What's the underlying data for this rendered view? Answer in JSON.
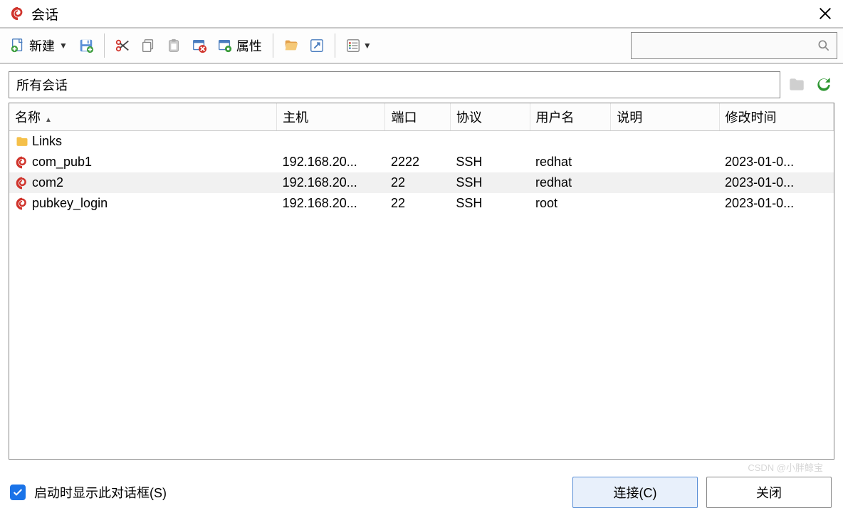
{
  "window": {
    "title": "会话"
  },
  "toolbar": {
    "new_label": "新建",
    "prop_label": "属性"
  },
  "filter": {
    "crumb": "所有会话"
  },
  "table": {
    "headers": [
      "名称",
      "主机",
      "端口",
      "协议",
      "用户名",
      "说明",
      "修改时间"
    ],
    "rows": [
      {
        "type": "folder",
        "name": "Links",
        "host": "",
        "port": "",
        "proto": "",
        "user": "",
        "desc": "",
        "mtime": "",
        "selected": false
      },
      {
        "type": "session",
        "name": "com_pub1",
        "host": "192.168.20...",
        "port": "2222",
        "proto": "SSH",
        "user": "redhat",
        "desc": "",
        "mtime": "2023-01-0...",
        "selected": false
      },
      {
        "type": "session",
        "name": "com2",
        "host": "192.168.20...",
        "port": "22",
        "proto": "SSH",
        "user": "redhat",
        "desc": "",
        "mtime": "2023-01-0...",
        "selected": true
      },
      {
        "type": "session",
        "name": "pubkey_login",
        "host": "192.168.20...",
        "port": "22",
        "proto": "SSH",
        "user": "root",
        "desc": "",
        "mtime": "2023-01-0...",
        "selected": false
      }
    ]
  },
  "footer": {
    "check_label": "启动时显示此对话框(S)",
    "connect": "连接(C)",
    "close": "关闭"
  },
  "watermark": "CSDN @小胖鲸宝"
}
